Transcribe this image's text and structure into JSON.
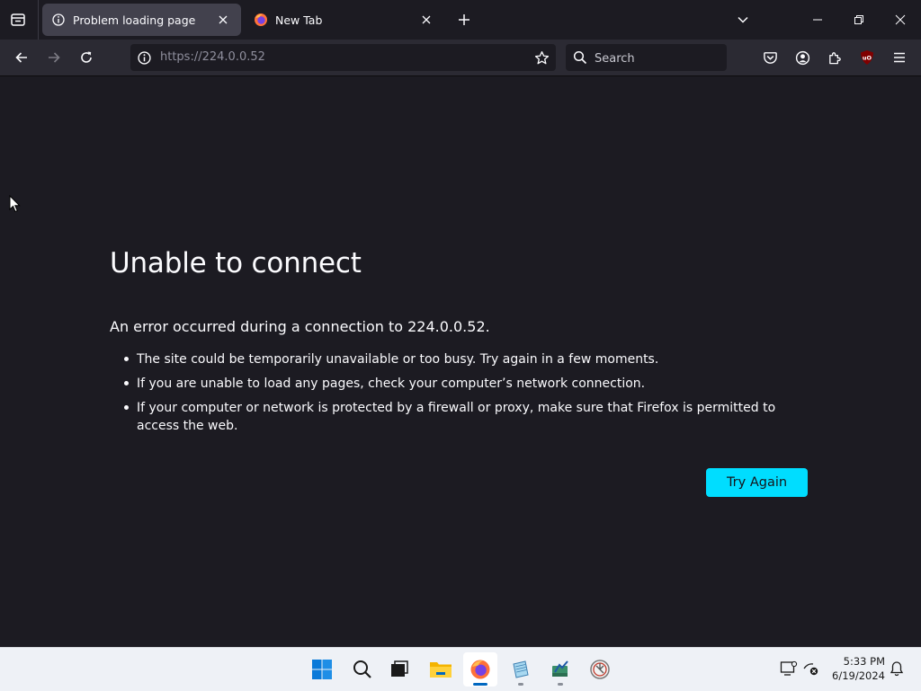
{
  "browser": {
    "tabs": [
      {
        "title": "Problem loading page",
        "icon": "info-icon",
        "active": true
      },
      {
        "title": "New Tab",
        "icon": "firefox-icon",
        "active": false
      }
    ],
    "url": "https://224.0.0.52",
    "search_placeholder": "Search",
    "extension_badge": "uO"
  },
  "error_page": {
    "title": "Unable to connect",
    "description": "An error occurred during a connection to 224.0.0.52.",
    "items": [
      "The site could be temporarily unavailable or too busy. Try again in a few moments.",
      "If you are unable to load any pages, check your computer’s network connection.",
      "If your computer or network is protected by a firewall or proxy, make sure that Firefox is permitted to access the web."
    ],
    "button_label": "Try Again"
  },
  "taskbar": {
    "apps": [
      "start-icon",
      "search-icon",
      "task-view-icon",
      "file-explorer-icon",
      "firefox-icon",
      "notepad-icon",
      "app-icon",
      "settings-app-icon"
    ],
    "time": "5:33 PM",
    "date": "6/19/2024"
  },
  "colors": {
    "background": "#1c1b22",
    "toolbar": "#2b2a33",
    "accent_button": "#00ddff",
    "taskbar": "#eef1f6"
  }
}
